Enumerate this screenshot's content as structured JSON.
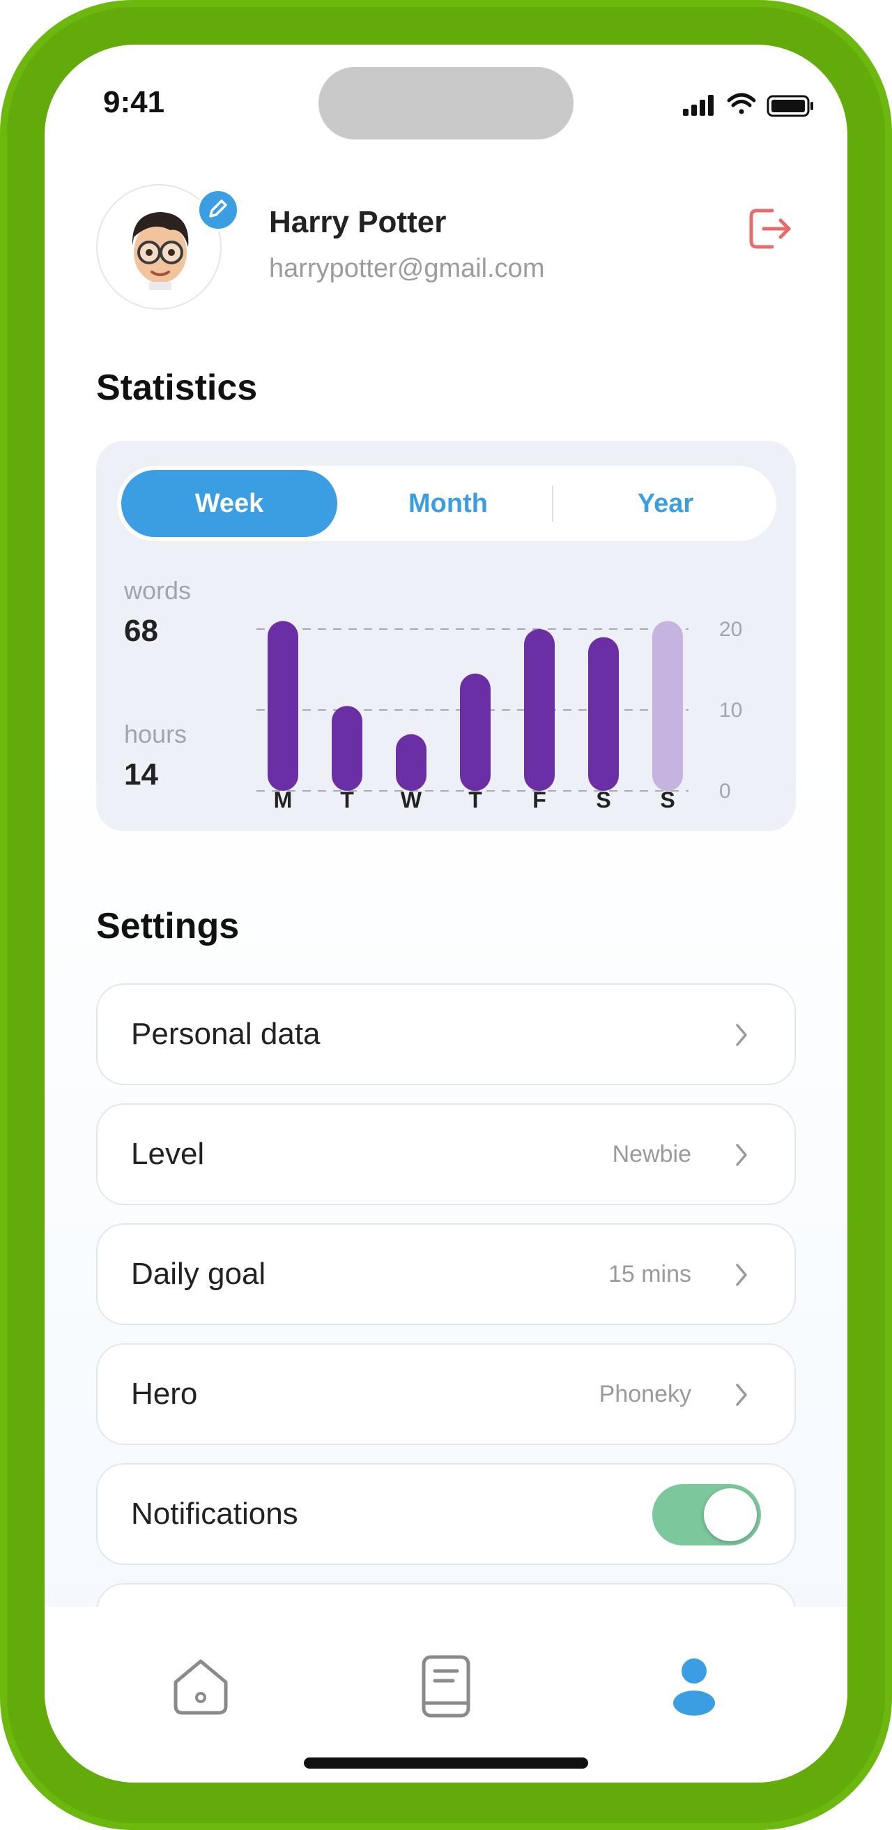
{
  "status_bar": {
    "time": "9:41"
  },
  "profile": {
    "name": "Harry Potter",
    "email": "harrypotter@gmail.com"
  },
  "statistics": {
    "title": "Statistics",
    "tabs": [
      {
        "label": "Week",
        "active": true
      },
      {
        "label": "Month",
        "active": false
      },
      {
        "label": "Year",
        "active": false
      }
    ],
    "summary": [
      {
        "label": "words",
        "value": "68"
      },
      {
        "label": "hours",
        "value": "14"
      }
    ]
  },
  "chart_data": {
    "type": "bar",
    "categories": [
      "M",
      "T",
      "W",
      "T",
      "F",
      "S",
      "S"
    ],
    "values": [
      21,
      10.5,
      7,
      14.5,
      20,
      19,
      21
    ],
    "highlight_last_light": true,
    "yticks": [
      "20",
      "10",
      "0"
    ],
    "ylim": [
      0,
      20
    ],
    "grid": "dashed",
    "colors": {
      "bar": "#6b2fa5",
      "bar_light": "#c6b4e0"
    }
  },
  "settings": {
    "title": "Settings",
    "items": [
      {
        "label": "Personal data",
        "value": ""
      },
      {
        "label": "Level",
        "value": "Newbie"
      },
      {
        "label": "Daily goal",
        "value": "15 mins"
      },
      {
        "label": "Hero",
        "value": "Phoneky"
      },
      {
        "label": "Notifications",
        "toggle": true
      }
    ]
  },
  "bottom_nav": [
    {
      "icon": "home-icon",
      "active": false
    },
    {
      "icon": "book-icon",
      "active": false
    },
    {
      "icon": "profile-icon",
      "active": true
    }
  ],
  "colors": {
    "accent": "#3c9ee2",
    "frame": "#6cb80f",
    "logout": "#e66b6b",
    "toggle_on": "#7cc79c"
  }
}
